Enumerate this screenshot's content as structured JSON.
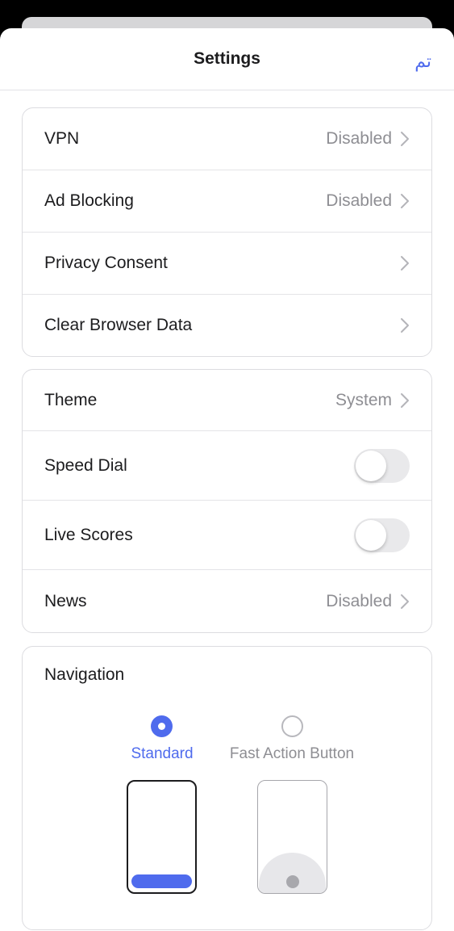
{
  "header": {
    "title": "Settings",
    "done_label": "تم"
  },
  "group1": {
    "vpn": {
      "label": "VPN",
      "value": "Disabled"
    },
    "ad_blocking": {
      "label": "Ad Blocking",
      "value": "Disabled"
    },
    "privacy_consent": {
      "label": "Privacy Consent"
    },
    "clear_browser_data": {
      "label": "Clear Browser Data"
    }
  },
  "group2": {
    "theme": {
      "label": "Theme",
      "value": "System"
    },
    "speed_dial": {
      "label": "Speed Dial",
      "enabled": false
    },
    "live_scores": {
      "label": "Live Scores",
      "enabled": false
    },
    "news": {
      "label": "News",
      "value": "Disabled"
    }
  },
  "navigation": {
    "title": "Navigation",
    "options": [
      {
        "label": "Standard",
        "selected": true
      },
      {
        "label": "Fast Action Button",
        "selected": false
      }
    ]
  },
  "colors": {
    "accent": "#4f6bed",
    "secondary_text": "#8e8e93",
    "toggle_off": "#e9e9eb"
  }
}
